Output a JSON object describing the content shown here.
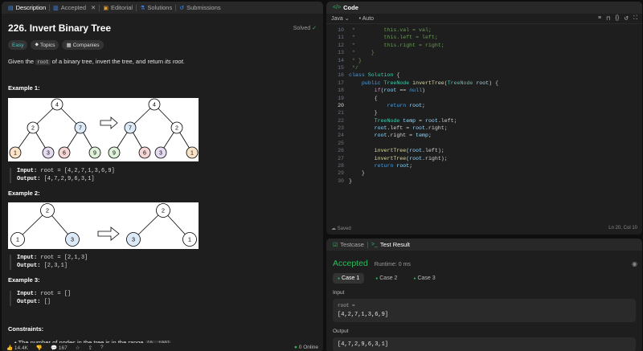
{
  "left_tabs": [
    {
      "label": "Description",
      "icon": "description-icon"
    },
    {
      "label": "Accepted",
      "icon": "accepted-icon"
    },
    {
      "label": "Editorial",
      "icon": "editorial-icon"
    },
    {
      "label": "Solutions",
      "icon": "solutions-icon"
    },
    {
      "label": "Submissions",
      "icon": "submissions-icon"
    }
  ],
  "problem": {
    "title": "226. Invert Binary Tree",
    "status": "Solved",
    "difficulty": "Easy",
    "topics_label": "Topics",
    "companies_label": "Companies",
    "desc_pre": "Given the ",
    "desc_code": "root",
    "desc_mid": " of a binary tree, invert the tree, and return ",
    "desc_em": "its root",
    "desc_post": "."
  },
  "examples": [
    {
      "heading": "Example 1:",
      "input_label": "Input:",
      "input": " root = [4,2,7,1,3,6,9]",
      "output_label": "Output:",
      "output": " [4,7,2,9,6,3,1]"
    },
    {
      "heading": "Example 2:",
      "input_label": "Input:",
      "input": " root = [2,1,3]",
      "output_label": "Output:",
      "output": " [2,3,1]"
    },
    {
      "heading": "Example 3:",
      "input_label": "Input:",
      "input": " root = []",
      "output_label": "Output:",
      "output": " []"
    }
  ],
  "tree1": {
    "left": {
      "root": "4",
      "l": "2",
      "r": "7",
      "ll": "1",
      "lr": "3",
      "rl": "6",
      "rr": "9"
    },
    "right": {
      "root": "4",
      "l": "7",
      "r": "2",
      "ll": "9",
      "lr": "6",
      "rl": "3",
      "rr": "1"
    }
  },
  "tree2": {
    "left": {
      "root": "2",
      "l": "1",
      "r": "3"
    },
    "right": {
      "root": "2",
      "l": "3",
      "r": "1"
    }
  },
  "constraints": {
    "heading": "Constraints:",
    "item_text": "The number of nodes in the tree is in the range ",
    "item_code": "[0, 100]"
  },
  "footer": {
    "likes": "14.4K",
    "comments": "167",
    "online": "0 Online"
  },
  "code_panel": {
    "title": "Code",
    "language": "Java",
    "auto": "Auto",
    "saved": "Saved",
    "cursor_pos": "Ln 20, Col 10"
  },
  "code_lines": [
    {
      "n": "10",
      "t": " *         this.val = val;",
      "k": "cm"
    },
    {
      "n": "11",
      "t": " *         this.left = left;",
      "k": "cm"
    },
    {
      "n": "12",
      "t": " *         this.right = right;",
      "k": "cm"
    },
    {
      "n": "13",
      "t": " *     }",
      "k": "cm"
    },
    {
      "n": "14",
      "t": " * }",
      "k": "cm"
    },
    {
      "n": "15",
      "t": " */",
      "k": "cm"
    },
    {
      "n": "16",
      "t": "class Solution {",
      "k": "class"
    },
    {
      "n": "17",
      "t": "    public TreeNode invertTree(TreeNode root) {",
      "k": "sig"
    },
    {
      "n": "18",
      "t": "        if(root == null)",
      "k": "if"
    },
    {
      "n": "19",
      "t": "        {",
      "k": "plain"
    },
    {
      "n": "20",
      "t": "            return root;",
      "k": "ret"
    },
    {
      "n": "21",
      "t": "        }",
      "k": "plain"
    },
    {
      "n": "22",
      "t": "        TreeNode temp = root.left;",
      "k": "decl"
    },
    {
      "n": "23",
      "t": "        root.left = root.right;",
      "k": "id"
    },
    {
      "n": "24",
      "t": "        root.right = temp;",
      "k": "id"
    },
    {
      "n": "25",
      "t": "",
      "k": "plain"
    },
    {
      "n": "26",
      "t": "        invertTree(root.left);",
      "k": "call"
    },
    {
      "n": "27",
      "t": "        invertTree(root.right);",
      "k": "call"
    },
    {
      "n": "28",
      "t": "        return root;",
      "k": "ret"
    },
    {
      "n": "29",
      "t": "    }",
      "k": "plain"
    },
    {
      "n": "30",
      "t": "}",
      "k": "plain"
    }
  ],
  "result_panel": {
    "tab_testcase": "Testcase",
    "tab_result": "Test Result",
    "verdict": "Accepted",
    "runtime": "Runtime: 0 ms",
    "cases": [
      "Case 1",
      "Case 2",
      "Case 3"
    ],
    "input_label": "Input",
    "var_name": "root =",
    "var_value": "[4,2,7,1,3,6,9]",
    "output_label": "Output",
    "output_value": "[4,7,2,9,6,3,1]"
  },
  "colors": {
    "accent_green": "#2cbb5d",
    "easy": "#46c6c2",
    "node_orange": "#fbe3c8",
    "node_purple": "#e5dcf2",
    "node_red": "#f6d5d5",
    "node_green": "#dff1d9",
    "node_blue": "#dce9f7"
  }
}
